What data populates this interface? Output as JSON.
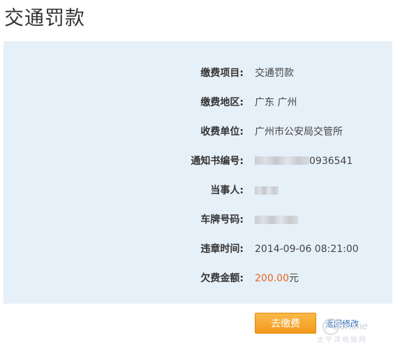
{
  "page": {
    "title": "交通罚款"
  },
  "details": [
    {
      "label": "缴费项目:",
      "value": "交通罚款"
    },
    {
      "label": "缴费地区:",
      "value": "广东 广州"
    },
    {
      "label": "收费单位:",
      "value": "广州市公安局交管所"
    },
    {
      "label": "通知书编号:",
      "value": "0936541"
    },
    {
      "label": "当事人:",
      "value": ""
    },
    {
      "label": "车牌号码:",
      "value": ""
    },
    {
      "label": "违章时间:",
      "value": "2014-09-06 08:21:00"
    },
    {
      "label": "欠费金额:",
      "value": "200.00",
      "unit": "元"
    }
  ],
  "actions": {
    "pay_label": "去缴费",
    "back_label": "返回修改"
  },
  "watermark": {
    "text": "PConline",
    "subtext": "太平洋电脑网"
  },
  "colors": {
    "panel_bg": "#e6f0f8",
    "amount": "#e8641b",
    "pay_button": "#f5a623",
    "link": "#2a6cb8"
  }
}
